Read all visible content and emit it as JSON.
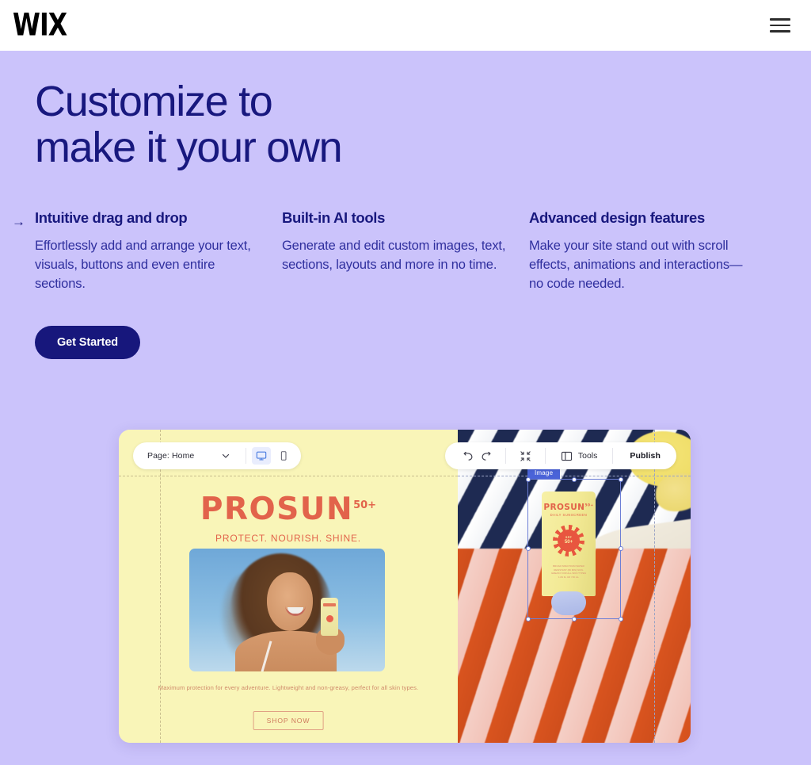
{
  "header": {
    "logo_text": "WIX",
    "menu_icon": "hamburger-menu-icon"
  },
  "hero": {
    "title_line1": "Customize to",
    "title_line2": "make it your own",
    "bg_color": "#cbc3fb",
    "text_color": "#18187e",
    "arrow_glyph": "→",
    "features": [
      {
        "title": "Intuitive drag and drop",
        "desc": "Effortlessly add and arrange your text, visuals, buttons and even entire sections.",
        "active": true
      },
      {
        "title": "Built-in AI tools",
        "desc": "Generate and edit custom images, text, sections, layouts and more in no time.",
        "active": false
      },
      {
        "title": "Advanced design features",
        "desc": "Make your site stand out with scroll effects, animations and interactions—no code needed.",
        "active": false
      }
    ],
    "cta_label": "Get Started",
    "cta_color": "#17177c"
  },
  "editor": {
    "toolbar_left": {
      "page_label": "Page: Home",
      "chevron_icon": "chevron-down-icon",
      "desktop_icon": "desktop-view-icon",
      "mobile_icon": "mobile-view-icon",
      "active_view": "desktop"
    },
    "toolbar_right": {
      "undo_icon": "undo-icon",
      "redo_icon": "redo-icon",
      "fullscreen_icon": "collapse-fullscreen-icon",
      "tools_icon": "panel-layout-icon",
      "tools_label": "Tools",
      "publish_label": "Publish"
    },
    "selection": {
      "label": "Image",
      "accent_color": "#4a63d8",
      "cursor_icon": "pointer-cursor-icon"
    },
    "site_preview": {
      "bg_color": "#f9f5b8",
      "brand_color": "#e2634b",
      "brand_name": "PROSUN",
      "brand_superscript": "50+",
      "tagline": "PROTECT. NOURISH. SHINE.",
      "body_copy": "Maximum protection for every adventure. Lightweight and non-greasy, perfect for all skin types.",
      "shop_label": "SHOP NOW",
      "tube_brand": "PROSUN",
      "tube_brand_sup": "50+",
      "tube_sub": "DAILY SUNSCREEN",
      "tube_badge_top": "SPF",
      "tube_badge_value": "50+",
      "tube_fineprint": "BROAD SPECTRUM\nWATER RESISTANT (80 MIN)\nNON-GREASY\nFOR ALL SKIN TYPES\n1.69 FL OZ / 50 mL"
    }
  }
}
